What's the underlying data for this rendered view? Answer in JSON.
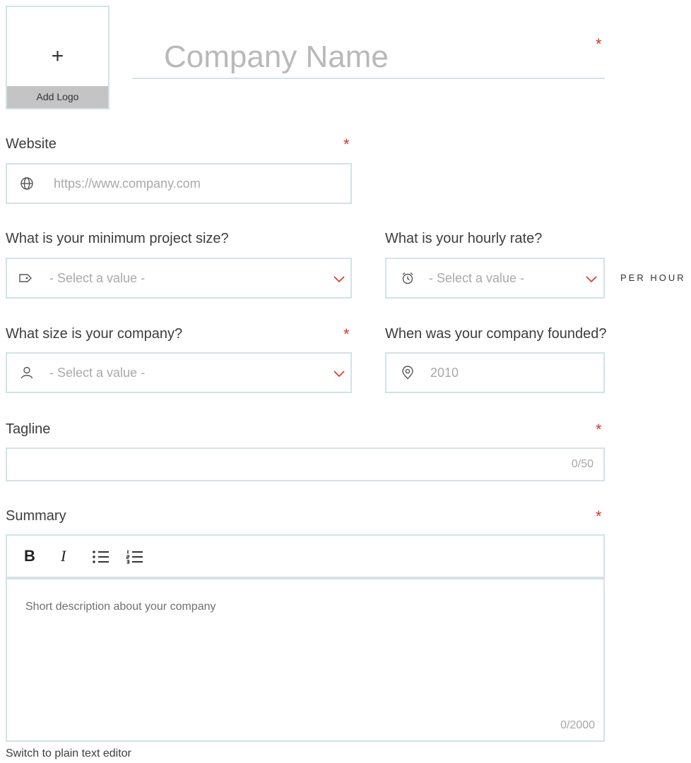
{
  "logo": {
    "plus": "+",
    "label": "Add Logo"
  },
  "company_name": {
    "placeholder": "Company Name",
    "required": "*"
  },
  "website": {
    "label": "Website",
    "required": "*",
    "placeholder": "https://www.company.com",
    "icon": "globe-icon"
  },
  "min_project_size": {
    "label": "What is your minimum project size?",
    "selected": "- Select a value -",
    "icon": "tag-icon"
  },
  "hourly_rate": {
    "label": "What is your hourly rate?",
    "selected": "- Select a value -",
    "icon": "alarm-clock-icon",
    "suffix": "PER HOUR"
  },
  "company_size": {
    "label": "What size is your company?",
    "required": "*",
    "selected": "- Select a value -",
    "icon": "user-icon"
  },
  "founded": {
    "label": "When was your company founded?",
    "placeholder": "2010",
    "icon": "location-pin-icon"
  },
  "tagline": {
    "label": "Tagline",
    "required": "*",
    "counter": "0/50"
  },
  "summary": {
    "label": "Summary",
    "required": "*",
    "toolbar": {
      "bold": "B",
      "italic": "I"
    },
    "placeholder": "Short description about your company",
    "counter": "0/2000"
  },
  "switch_editor": "Switch to plain text editor",
  "colors": {
    "required": "#d5362b",
    "chevron": "#d5362b",
    "border": "#d3e2e5",
    "placeholder": "#a9a9a9"
  }
}
